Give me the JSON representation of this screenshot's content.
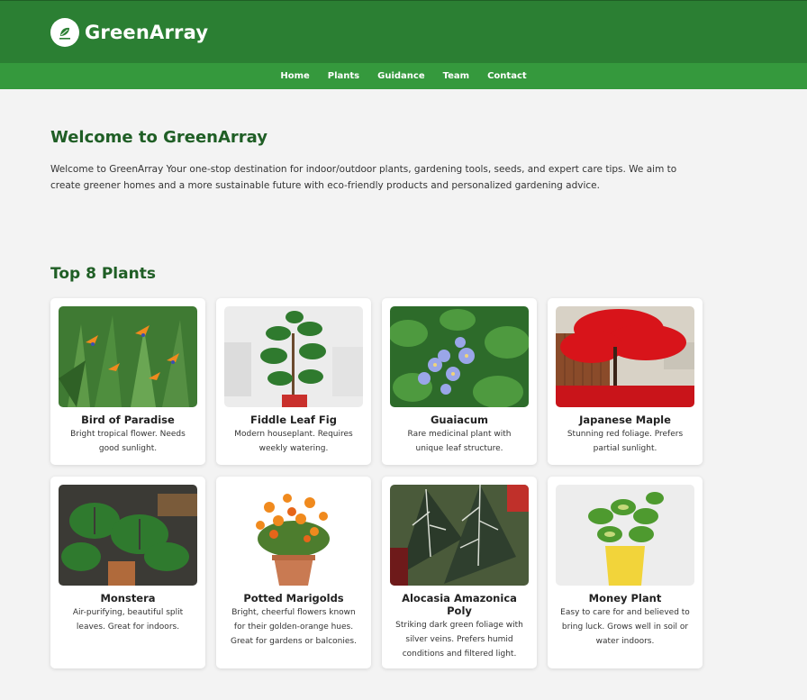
{
  "brand": {
    "name": "GreenArray",
    "logo_icon": "leaf-logo-icon"
  },
  "nav": [
    "Home",
    "Plants",
    "Guidance",
    "Team",
    "Contact"
  ],
  "welcome": {
    "title": "Welcome to GreenArray",
    "text": "Welcome to GreenArray Your one-stop destination for indoor/outdoor plants, gardening tools, seeds, and expert care tips. We aim to create greener homes and a more sustainable future with eco-friendly products and personalized gardening advice."
  },
  "plants_section": {
    "title": "Top 8 Plants",
    "plants": [
      {
        "name": "Bird of Paradise",
        "desc": "Bright tropical flower. Needs good sunlight."
      },
      {
        "name": "Fiddle Leaf Fig",
        "desc": "Modern houseplant. Requires weekly watering."
      },
      {
        "name": "Guaiacum",
        "desc": "Rare medicinal plant with unique leaf structure."
      },
      {
        "name": "Japanese Maple",
        "desc": "Stunning red foliage. Prefers partial sunlight."
      },
      {
        "name": "Monstera",
        "desc": "Air-purifying, beautiful split leaves. Great for indoors."
      },
      {
        "name": "Potted Marigolds",
        "desc": "Bright, cheerful flowers known for their golden-orange hues. Great for gardens or balconies."
      },
      {
        "name": "Alocasia Amazonica Poly",
        "desc": "Striking dark green foliage with silver veins. Prefers humid conditions and filtered light."
      },
      {
        "name": "Money Plant",
        "desc": "Easy to care for and believed to bring luck. Grows well in soil or water indoors."
      }
    ]
  },
  "colors": {
    "header": "#2b7f33",
    "nav": "#35993d",
    "heading": "#1f5e25",
    "background": "#f3f3f3"
  }
}
